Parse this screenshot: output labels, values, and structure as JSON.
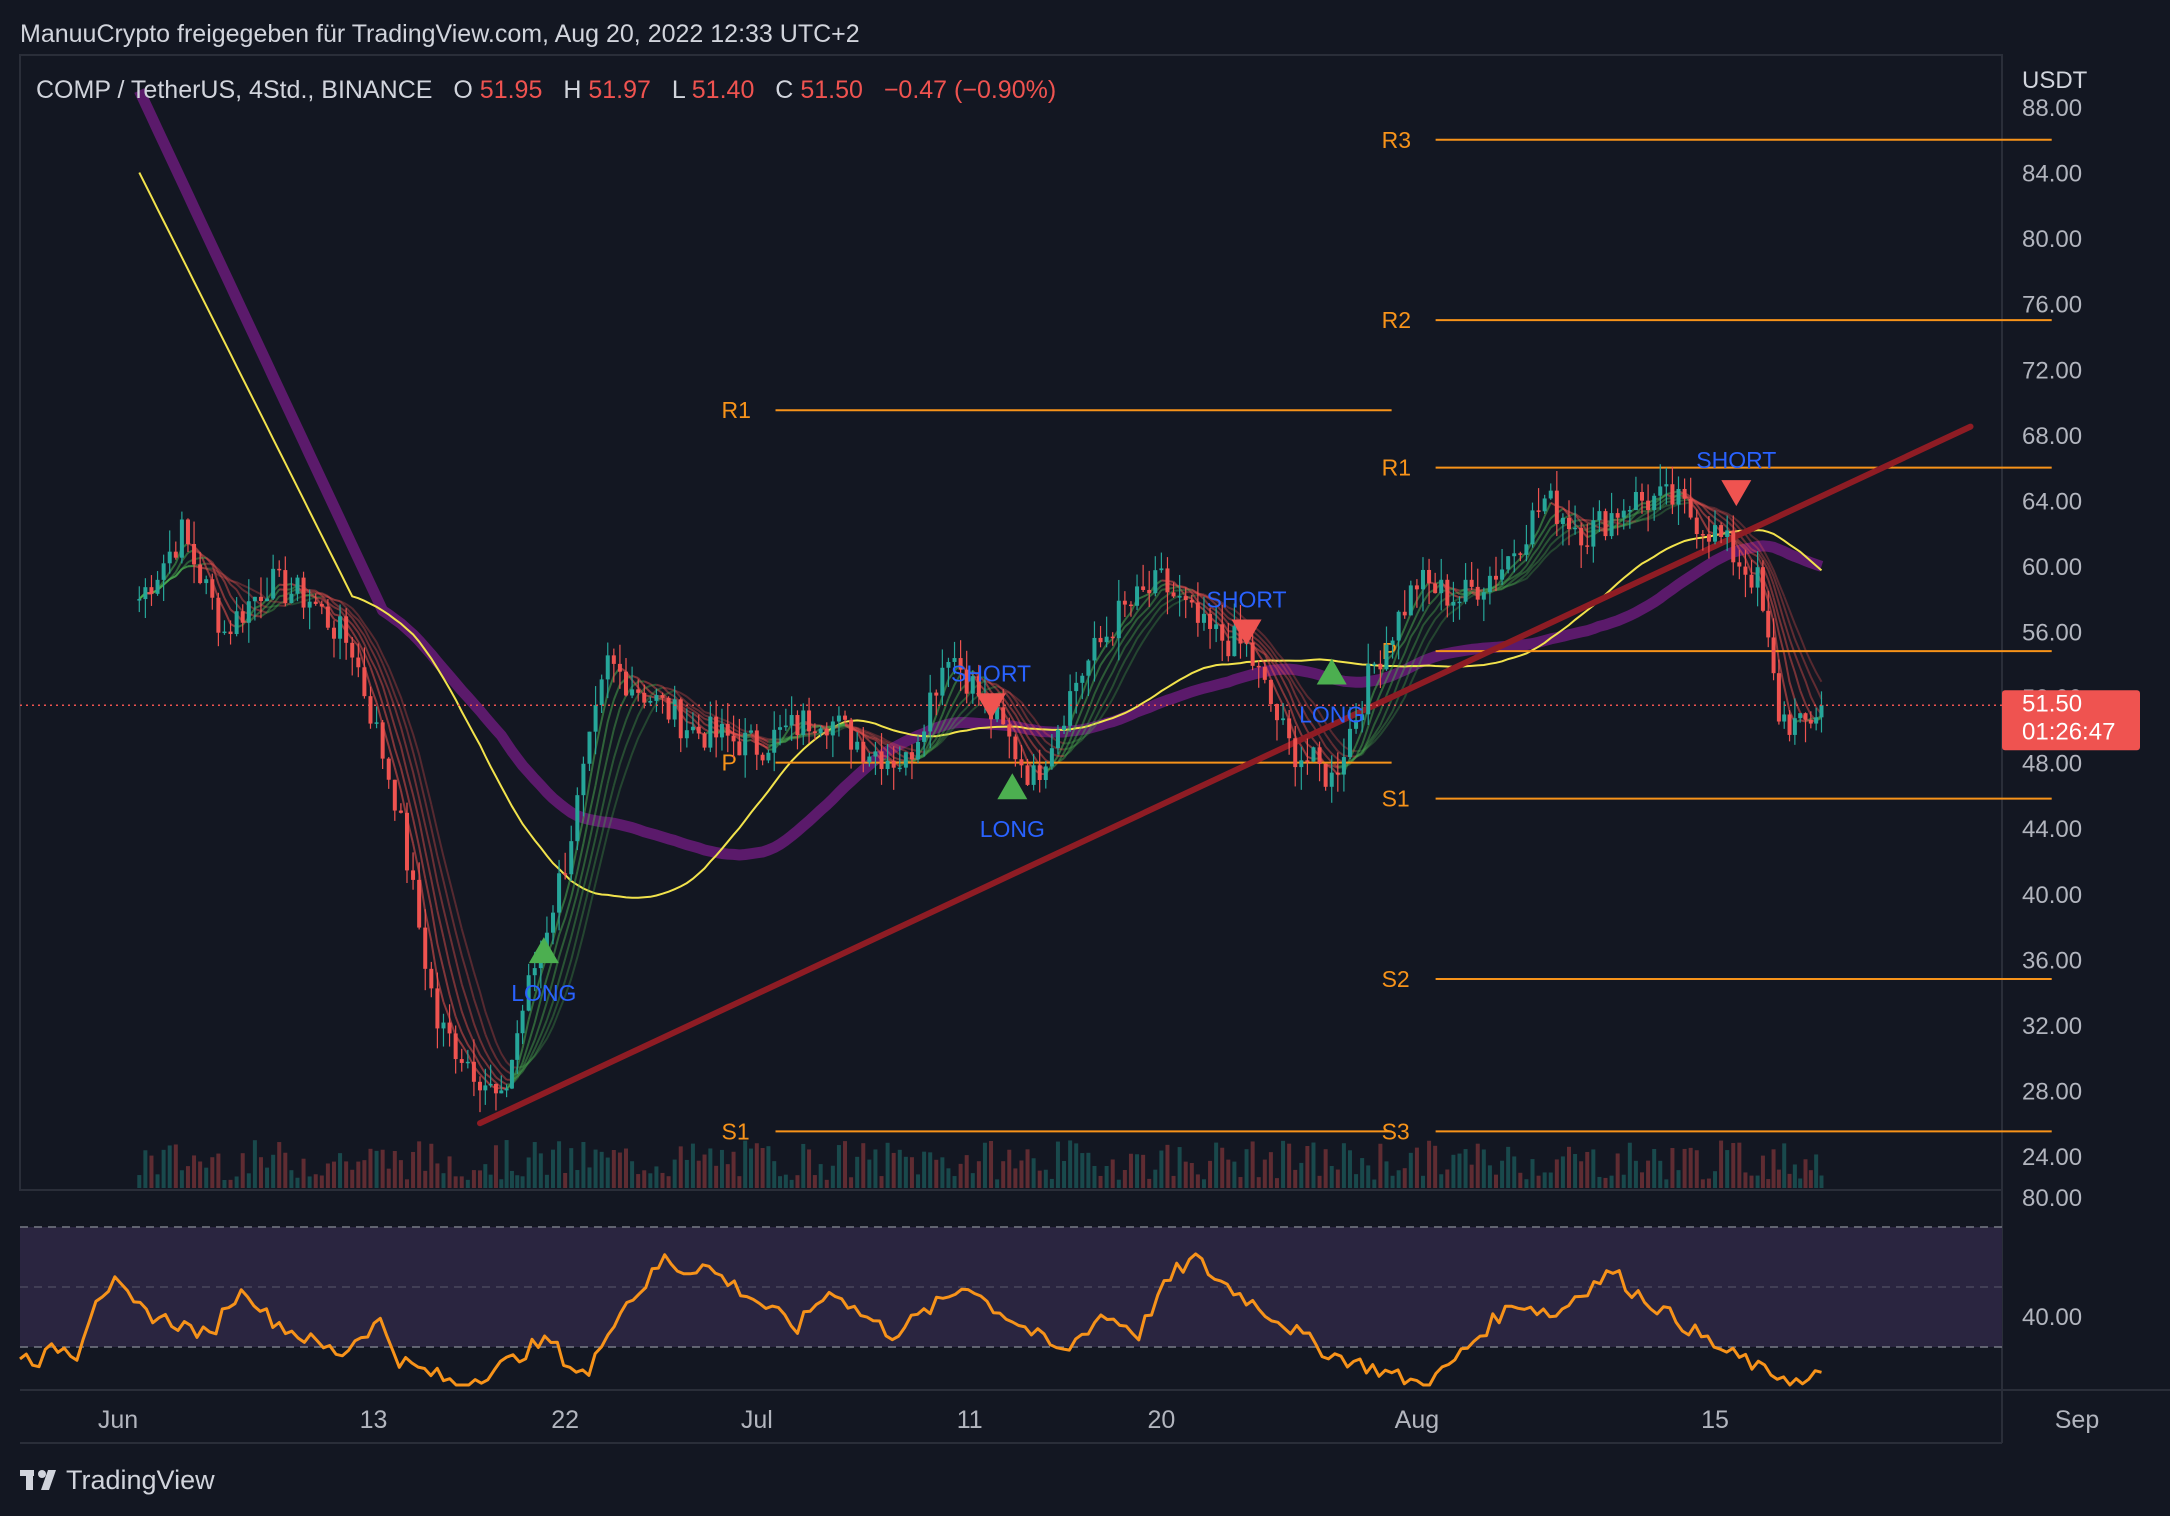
{
  "header": {
    "publisher_line": "ManuuCrypto freigegeben für TradingView.com, Aug 20, 2022 12:33 UTC+2",
    "symbol_line": "COMP / TetherUS, 4Std., BINANCE",
    "ohlc": {
      "o_label": "O",
      "o_value": "51.95",
      "h_label": "H",
      "h_value": "51.97",
      "l_label": "L",
      "l_value": "51.40",
      "c_label": "C",
      "c_value": "51.50",
      "change": "−0.47 (−0.90%)"
    }
  },
  "price_axis": {
    "currency": "USDT",
    "ticks": [
      "88.00",
      "84.00",
      "80.00",
      "76.00",
      "72.00",
      "68.00",
      "64.00",
      "60.00",
      "56.00",
      "52.00",
      "48.00",
      "44.00",
      "40.00",
      "36.00",
      "32.00",
      "28.00",
      "24.00"
    ],
    "current_price": "51.50",
    "countdown": "01:26:47"
  },
  "time_axis": {
    "ticks": [
      "Jun",
      "13",
      "22",
      "Jul",
      "11",
      "20",
      "Aug",
      "15",
      "Sep"
    ]
  },
  "osc_axis": {
    "ticks": [
      "80.00",
      "40.00"
    ]
  },
  "footer": {
    "brand": "TradingView"
  },
  "colors": {
    "background": "#131722",
    "grid_text": "#b2b5be",
    "pivot": "#f7931a",
    "trendline": "#8e1c24",
    "ma_purple": "#5b1a6b",
    "ma_yellow": "#f2e34c",
    "ribbon_up": "#4caf50",
    "ribbon_down": "#ef5350",
    "label_blue": "#2962ff",
    "price_tag": "#ef5350",
    "rsi_line": "#f7931a",
    "rsi_band": "#2a2540"
  },
  "chart_data": {
    "type": "line",
    "title": "COMP / TetherUS, 4Std., BINANCE",
    "ylabel": "USDT",
    "ylim": [
      22,
      90
    ],
    "x_ticks": [
      "Jun",
      "13",
      "22",
      "Jul",
      "11",
      "20",
      "Aug",
      "15",
      "Sep"
    ],
    "series": [
      {
        "name": "",
        "x": [
          "06-02",
          "06-04",
          "06-06",
          "06-08",
          "06-10",
          "06-12",
          "06-14",
          "06-16",
          "06-18",
          "06-19",
          "06-20",
          "06-22",
          "06-24",
          "06-26",
          "06-28",
          "07-01",
          "07-04",
          "07-06",
          "07-08",
          "07-10",
          "07-12",
          "07-14",
          "07-16",
          "07-18",
          "07-20",
          "07-22",
          "07-24",
          "07-26",
          "07-28",
          "07-30",
          "08-01",
          "08-03",
          "08-05",
          "08-07",
          "08-09",
          "08-11",
          "08-13",
          "08-15",
          "08-17",
          "08-18",
          "08-19",
          "08-20"
        ],
        "values": [
          58,
          62,
          56,
          59,
          58,
          55,
          46,
          32,
          29,
          27,
          33,
          42,
          54,
          52,
          50,
          49,
          51,
          49,
          48,
          55,
          51,
          47,
          53,
          57,
          59,
          56,
          55,
          49,
          47,
          54,
          59,
          58,
          60,
          64,
          62,
          64,
          64,
          62,
          59,
          51,
          50,
          51.5
        ]
      }
    ],
    "pivot_levels": [
      {
        "label": "R1",
        "value": 69.5,
        "from": "06-30",
        "to": "07-31"
      },
      {
        "label": "P",
        "value": 48.0,
        "from": "06-30",
        "to": "07-31"
      },
      {
        "label": "S1",
        "value": 25.5,
        "from": "06-30",
        "to": "07-31"
      },
      {
        "label": "R3",
        "value": 86.0,
        "from": "07-31",
        "to": "08-31"
      },
      {
        "label": "R2",
        "value": 75.0,
        "from": "07-31",
        "to": "08-31"
      },
      {
        "label": "R1",
        "value": 66.0,
        "from": "07-31",
        "to": "08-31"
      },
      {
        "label": "P",
        "value": 54.8,
        "from": "07-31",
        "to": "08-31"
      },
      {
        "label": "S1",
        "value": 45.8,
        "from": "07-31",
        "to": "08-31"
      },
      {
        "label": "S2",
        "value": 34.8,
        "from": "07-31",
        "to": "08-31"
      },
      {
        "label": "S3",
        "value": 25.5,
        "from": "07-31",
        "to": "08-31"
      }
    ],
    "trendline": {
      "from": {
        "x": "06-18",
        "y": 26
      },
      "to": {
        "x": "08-27",
        "y": 68.5
      }
    },
    "signals": [
      {
        "label": "LONG",
        "x": "06-21",
        "y": 36.5,
        "dir": "up"
      },
      {
        "label": "SHORT",
        "x": "07-12",
        "y": 51.5,
        "dir": "down"
      },
      {
        "label": "LONG",
        "x": "07-13",
        "y": 46.5,
        "dir": "up"
      },
      {
        "label": "SHORT",
        "x": "07-24",
        "y": 56,
        "dir": "down"
      },
      {
        "label": "LONG",
        "x": "07-28",
        "y": 53.5,
        "dir": "up"
      },
      {
        "label": "SHORT",
        "x": "08-16",
        "y": 64.5,
        "dir": "down"
      }
    ],
    "rsi": {
      "ylim": [
        30,
        90
      ],
      "band": [
        38,
        70
      ],
      "mid": 54,
      "values": [
        39,
        38,
        42,
        40,
        58,
        62,
        55,
        52,
        50,
        48,
        45,
        56,
        60,
        52,
        48,
        45,
        42,
        40,
        46,
        50,
        38,
        35,
        33,
        30,
        32,
        35,
        38,
        42,
        44,
        36,
        33,
        48,
        56,
        62,
        70,
        66,
        68,
        64,
        60,
        56,
        52,
        48,
        56,
        60,
        54,
        50,
        46,
        50,
        54,
        58,
        62,
        56,
        52,
        48,
        44,
        40,
        46,
        52,
        50,
        46,
        58,
        66,
        70,
        64,
        60,
        56,
        52,
        48,
        44,
        40,
        38,
        36,
        34,
        32,
        30,
        34,
        40,
        46,
        52,
        56,
        54,
        52,
        58,
        62,
        66,
        60,
        56,
        52,
        48,
        44,
        40,
        38,
        34,
        33,
        30,
        34
      ]
    }
  }
}
